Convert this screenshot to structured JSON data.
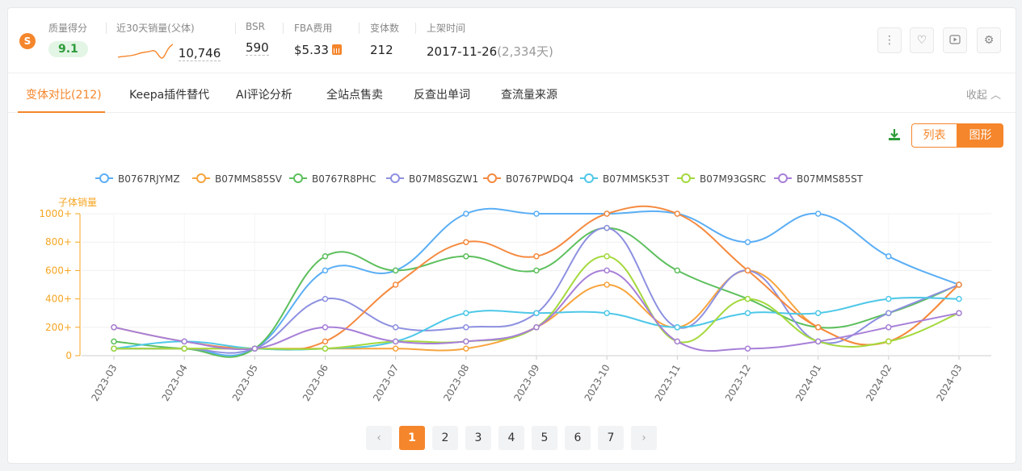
{
  "header": {
    "logo_glyph": "S",
    "quality": {
      "label": "质量得分",
      "value": "9.1"
    },
    "sales30": {
      "label": "近30天销量(父体)",
      "value": "10,746"
    },
    "bsr": {
      "label": "BSR",
      "value": "590"
    },
    "fba": {
      "label": "FBA费用",
      "value": "$5.33"
    },
    "variants": {
      "label": "变体数",
      "value": "212"
    },
    "listed": {
      "label": "上架时间",
      "date": "2017-11-26",
      "days": "(2,334天)"
    },
    "action_icons": [
      "more-vertical-icon",
      "heart-icon",
      "video-play-icon",
      "settings-icon"
    ]
  },
  "tabs": [
    {
      "label": "变体对比(212)",
      "active": true
    },
    {
      "label": "Keepa插件替代"
    },
    {
      "label": "AI评论分析"
    },
    {
      "label": "全站点售卖"
    },
    {
      "label": "反查出单词"
    },
    {
      "label": "查流量来源"
    }
  ],
  "collapse_label": "收起",
  "view_toggle": {
    "list": "列表",
    "chart": "图形",
    "selected": "图形"
  },
  "colors": {
    "accent": "#f5862c"
  },
  "chart_data": {
    "type": "line",
    "ylabel": "子体销量",
    "ylim": [
      0,
      1000
    ],
    "yticks": [
      "0",
      "200+",
      "400+",
      "600+",
      "800+",
      "1000+"
    ],
    "categories": [
      "2023-03",
      "2023-04",
      "2023-05",
      "2023-06",
      "2023-07",
      "2023-08",
      "2023-09",
      "2023-10",
      "2023-11",
      "2023-12",
      "2024-01",
      "2024-02",
      "2024-03"
    ],
    "legend_position": "top",
    "series": [
      {
        "name": "B0767RJYMZ",
        "color": "#5aaef5",
        "values": [
          50,
          50,
          50,
          600,
          600,
          1000,
          1000,
          1000,
          1000,
          800,
          1000,
          700,
          500
        ]
      },
      {
        "name": "B07MMS85SV",
        "color": "#f7a43d",
        "values": [
          50,
          50,
          50,
          50,
          50,
          50,
          200,
          500,
          200,
          600,
          200,
          100,
          500
        ]
      },
      {
        "name": "B0767R8PHC",
        "color": "#5cbf5c",
        "values": [
          100,
          50,
          50,
          700,
          600,
          700,
          600,
          900,
          600,
          400,
          200,
          300,
          500
        ]
      },
      {
        "name": "B07M8SGZW1",
        "color": "#8d90e0",
        "values": [
          50,
          50,
          50,
          400,
          200,
          200,
          300,
          900,
          200,
          600,
          100,
          300,
          500
        ]
      },
      {
        "name": "B0767PWDQ4",
        "color": "#f58a3f",
        "values": [
          200,
          100,
          50,
          100,
          500,
          800,
          700,
          1000,
          1000,
          600,
          200,
          100,
          500
        ]
      },
      {
        "name": "B07MMSK53T",
        "color": "#4ec8e8",
        "values": [
          50,
          100,
          50,
          50,
          100,
          300,
          300,
          300,
          200,
          300,
          300,
          400,
          400
        ]
      },
      {
        "name": "B07M93GSRC",
        "color": "#a4d93c",
        "values": [
          50,
          50,
          50,
          50,
          100,
          100,
          200,
          700,
          100,
          400,
          100,
          100,
          300
        ]
      },
      {
        "name": "B07MMS85ST",
        "color": "#a77fd8",
        "values": [
          200,
          100,
          50,
          200,
          100,
          100,
          200,
          600,
          100,
          50,
          100,
          200,
          300
        ]
      }
    ]
  },
  "pagination": {
    "pages": [
      "1",
      "2",
      "3",
      "4",
      "5",
      "6",
      "7"
    ],
    "current": "1",
    "prev": "‹",
    "next": "›"
  }
}
